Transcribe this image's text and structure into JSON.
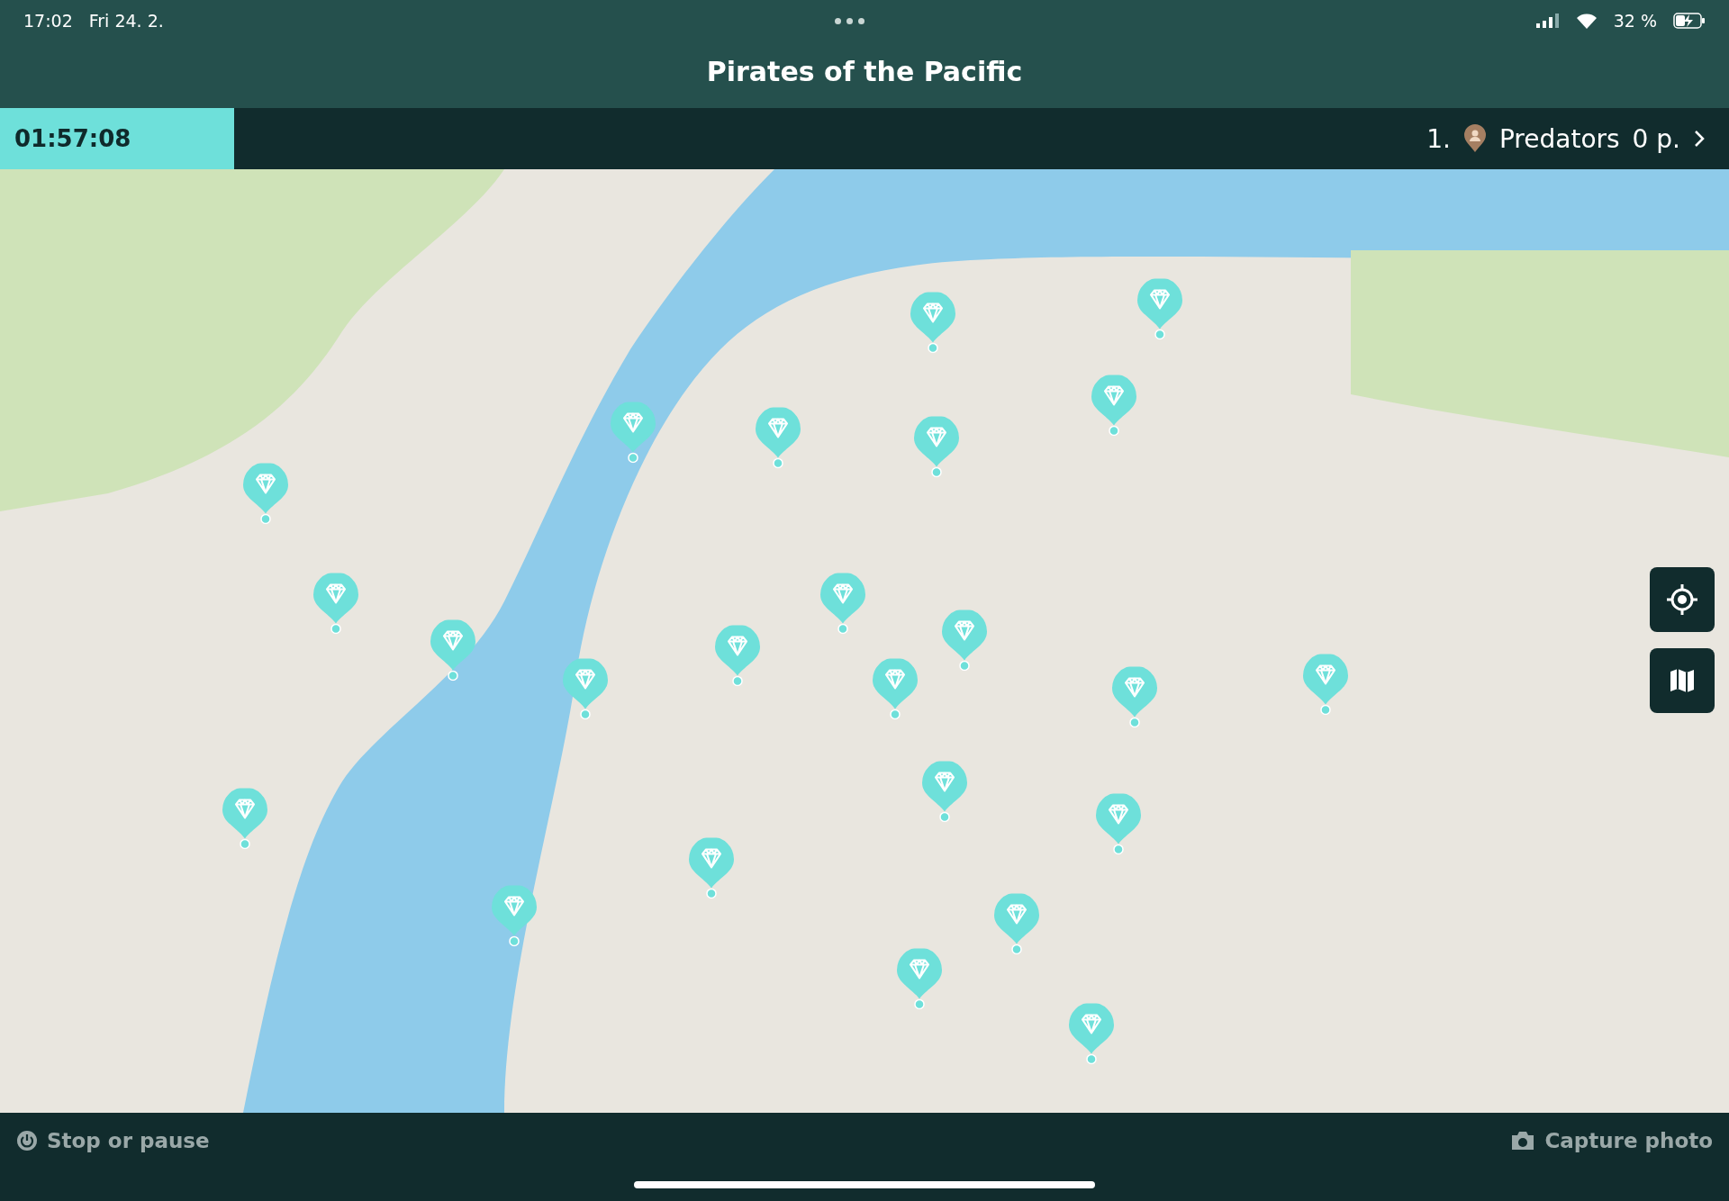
{
  "status_bar": {
    "time": "17:02",
    "date": "Fri 24. 2.",
    "battery": "32 %"
  },
  "title": "Pirates of the Pacific",
  "timer": "01:57:08",
  "leader": {
    "rank": "1.",
    "team": "Predators",
    "points": "0 p."
  },
  "map": {
    "pins": [
      {
        "kind": "gem"
      },
      {
        "kind": "gem"
      },
      {
        "kind": "gem"
      },
      {
        "kind": "gem"
      },
      {
        "kind": "gem"
      },
      {
        "kind": "gem"
      },
      {
        "kind": "gem"
      },
      {
        "kind": "gem"
      },
      {
        "kind": "gem"
      },
      {
        "kind": "gem"
      },
      {
        "kind": "gem"
      },
      {
        "kind": "gem"
      },
      {
        "kind": "gem"
      },
      {
        "kind": "gem"
      },
      {
        "kind": "gem"
      },
      {
        "kind": "gem"
      },
      {
        "kind": "gem"
      },
      {
        "kind": "gem"
      },
      {
        "kind": "gem"
      },
      {
        "kind": "gem"
      },
      {
        "kind": "gem"
      },
      {
        "kind": "gem"
      },
      {
        "kind": "gem"
      },
      {
        "kind": "gem"
      }
    ]
  },
  "map_controls": [
    {
      "kind": "locate"
    },
    {
      "kind": "map"
    }
  ],
  "bottom_bar": {
    "stop": "Stop or pause",
    "capture": "Capture photo"
  }
}
